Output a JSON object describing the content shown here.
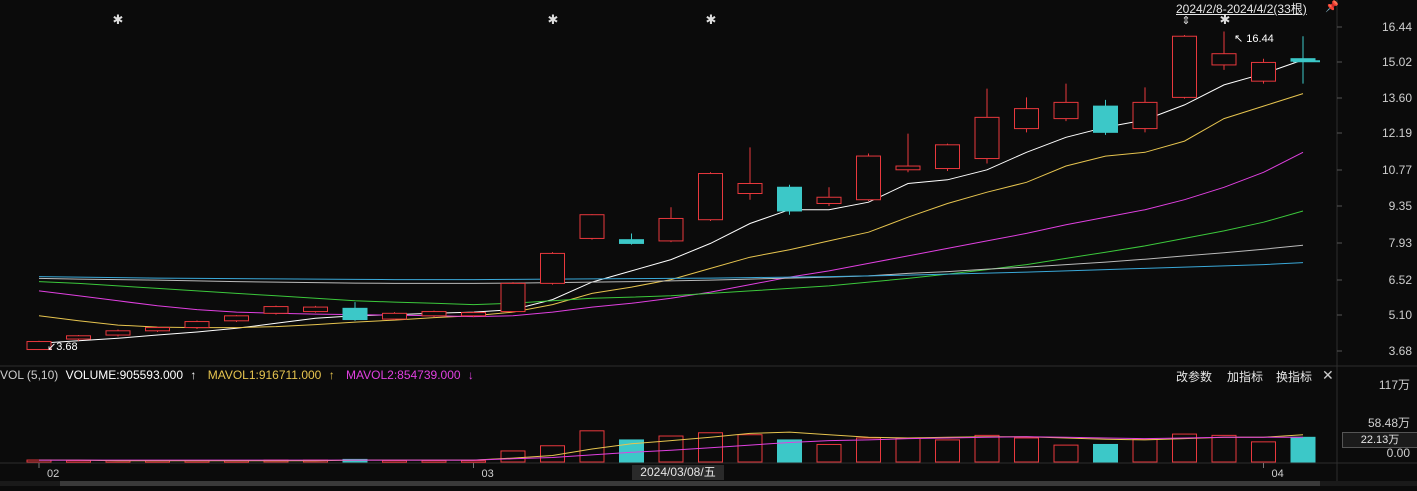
{
  "range_label": "2024/2/8-2024/4/2(33根)",
  "max_marker": "16.44",
  "min_marker": "3.68",
  "price_ticks": [
    "16.44",
    "15.02",
    "13.60",
    "12.19",
    "10.77",
    "9.35",
    "7.93",
    "6.52",
    "5.10",
    "3.68"
  ],
  "volume_ticks": [
    "117万",
    "58.48万",
    "0.00"
  ],
  "current_volume": "22.13万",
  "date_labels": [
    "02",
    "03",
    "04"
  ],
  "crosshair_date": "2024/03/08/五",
  "volume_legend": {
    "name": "VOL (5,10)",
    "volume": "VOLUME:905593.000",
    "volume_arrow": "↑",
    "mavol1": "MAVOL1:916711.000",
    "mavol1_arrow": "↑",
    "mavol2": "MAVOL2:854739.000",
    "mavol2_arrow": "↓"
  },
  "buttons": {
    "params": "改参数",
    "add_indicator": "加指标",
    "switch_indicator": "换指标"
  },
  "colors": {
    "up": "#e8383d",
    "down": "#3cc8c8",
    "ma5": "#ffffff",
    "ma10": "#e6c44f",
    "ma20": "#e040e0",
    "ma30": "#3cc83c",
    "ma60": "#bbbbbb",
    "ma120": "#3aa8d8",
    "mavol1": "#e6c44f",
    "mavol2": "#e040e0",
    "background": "#0b0b0b"
  },
  "chart_data": {
    "type": "candlestick",
    "price_ylim": [
      3.2,
      16.9
    ],
    "volume_ylim": [
      0,
      117
    ],
    "candles": [
      {
        "o": 3.7,
        "c": 4.02,
        "h": 4.05,
        "l": 3.68
      },
      {
        "o": 4.12,
        "c": 4.25,
        "h": 4.28,
        "l": 4.05
      },
      {
        "o": 4.28,
        "c": 4.45,
        "h": 4.5,
        "l": 4.22
      },
      {
        "o": 4.45,
        "c": 4.58,
        "h": 4.62,
        "l": 4.4
      },
      {
        "o": 4.58,
        "c": 4.82,
        "h": 4.86,
        "l": 4.52
      },
      {
        "o": 4.85,
        "c": 5.05,
        "h": 5.08,
        "l": 4.8
      },
      {
        "o": 5.15,
        "c": 5.42,
        "h": 5.46,
        "l": 5.1
      },
      {
        "o": 5.22,
        "c": 5.4,
        "h": 5.45,
        "l": 5.18
      },
      {
        "o": 5.35,
        "c": 4.9,
        "h": 5.6,
        "l": 4.85
      },
      {
        "o": 4.92,
        "c": 5.15,
        "h": 5.2,
        "l": 4.88
      },
      {
        "o": 5.05,
        "c": 5.22,
        "h": 5.26,
        "l": 5.0
      },
      {
        "o": 5.05,
        "c": 5.18,
        "h": 5.22,
        "l": 5.0
      },
      {
        "o": 5.22,
        "c": 6.35,
        "h": 6.4,
        "l": 5.18
      },
      {
        "o": 6.35,
        "c": 7.55,
        "h": 7.6,
        "l": 6.3
      },
      {
        "o": 8.15,
        "c": 9.1,
        "h": 9.12,
        "l": 8.1
      },
      {
        "o": 8.1,
        "c": 7.95,
        "h": 8.35,
        "l": 7.9
      },
      {
        "o": 8.05,
        "c": 8.95,
        "h": 9.4,
        "l": 8.0
      },
      {
        "o": 8.9,
        "c": 10.75,
        "h": 10.8,
        "l": 8.85
      },
      {
        "o": 9.95,
        "c": 10.35,
        "h": 11.8,
        "l": 9.7
      },
      {
        "o": 10.2,
        "c": 9.25,
        "h": 10.3,
        "l": 9.1
      },
      {
        "o": 9.55,
        "c": 9.8,
        "h": 10.2,
        "l": 9.45
      },
      {
        "o": 9.7,
        "c": 11.45,
        "h": 11.55,
        "l": 9.65
      },
      {
        "o": 10.9,
        "c": 11.05,
        "h": 12.35,
        "l": 10.8
      },
      {
        "o": 10.95,
        "c": 11.9,
        "h": 11.95,
        "l": 10.85
      },
      {
        "o": 11.35,
        "c": 13.0,
        "h": 14.15,
        "l": 11.15
      },
      {
        "o": 12.55,
        "c": 13.35,
        "h": 13.8,
        "l": 12.4
      },
      {
        "o": 12.95,
        "c": 13.6,
        "h": 14.35,
        "l": 12.85
      },
      {
        "o": 13.45,
        "c": 12.4,
        "h": 13.7,
        "l": 12.3
      },
      {
        "o": 12.55,
        "c": 13.6,
        "h": 14.2,
        "l": 12.4
      },
      {
        "o": 13.8,
        "c": 16.25,
        "h": 16.3,
        "l": 13.75
      },
      {
        "o": 15.1,
        "c": 15.55,
        "h": 16.44,
        "l": 14.9
      },
      {
        "o": 14.45,
        "c": 15.2,
        "h": 15.35,
        "l": 14.35
      },
      {
        "o": 15.35,
        "c": 15.25,
        "h": 16.25,
        "l": 14.35
      }
    ],
    "volumes": [
      3,
      2,
      2,
      2,
      2,
      2,
      3,
      3,
      4,
      2,
      2,
      2,
      17,
      25,
      48,
      34,
      40,
      45,
      42,
      34,
      27,
      37,
      37,
      34,
      41,
      37,
      26,
      27,
      35,
      43,
      41,
      31,
      38
    ],
    "ma_lines": [
      {
        "name": "MA5",
        "values": [
          3.95,
          4.05,
          4.15,
          4.28,
          4.4,
          4.55,
          4.75,
          4.95,
          5.05,
          5.1,
          5.15,
          5.2,
          5.3,
          5.7,
          6.4,
          6.85,
          7.3,
          7.95,
          8.75,
          9.3,
          9.3,
          9.6,
          10.35,
          10.5,
          10.9,
          11.6,
          12.2,
          12.6,
          12.9,
          13.5,
          14.3,
          14.75,
          15.3
        ]
      },
      {
        "name": "MA10",
        "values": [
          5.05,
          4.85,
          4.68,
          4.6,
          4.58,
          4.58,
          4.62,
          4.7,
          4.8,
          4.88,
          4.98,
          5.05,
          5.2,
          5.5,
          5.95,
          6.2,
          6.5,
          6.95,
          7.4,
          7.7,
          8.05,
          8.4,
          9.0,
          9.55,
          10.0,
          10.4,
          11.05,
          11.45,
          11.6,
          12.05,
          12.95,
          13.45,
          13.95
        ]
      },
      {
        "name": "MA20",
        "values": [
          6.05,
          5.85,
          5.65,
          5.45,
          5.3,
          5.2,
          5.15,
          5.12,
          5.1,
          5.08,
          5.05,
          5.02,
          5.05,
          5.2,
          5.4,
          5.55,
          5.75,
          6.0,
          6.3,
          6.6,
          6.85,
          7.15,
          7.45,
          7.75,
          8.05,
          8.35,
          8.7,
          9.0,
          9.3,
          9.7,
          10.2,
          10.8,
          11.6
        ]
      },
      {
        "name": "MA30",
        "values": [
          6.42,
          6.35,
          6.25,
          6.15,
          6.05,
          5.95,
          5.85,
          5.75,
          5.65,
          5.6,
          5.55,
          5.5,
          5.55,
          5.65,
          5.75,
          5.8,
          5.85,
          5.95,
          6.05,
          6.15,
          6.25,
          6.4,
          6.55,
          6.72,
          6.9,
          7.1,
          7.35,
          7.6,
          7.85,
          8.15,
          8.45,
          8.8,
          9.25
        ]
      },
      {
        "name": "MA60",
        "values": [
          6.55,
          6.52,
          6.5,
          6.48,
          6.45,
          6.42,
          6.4,
          6.38,
          6.36,
          6.35,
          6.35,
          6.35,
          6.36,
          6.38,
          6.4,
          6.42,
          6.45,
          6.48,
          6.52,
          6.56,
          6.6,
          6.65,
          6.75,
          6.82,
          6.92,
          7.0,
          7.1,
          7.2,
          7.32,
          7.45,
          7.58,
          7.72,
          7.88
        ]
      },
      {
        "name": "MA120",
        "values": [
          6.62,
          6.6,
          6.58,
          6.56,
          6.55,
          6.54,
          6.53,
          6.52,
          6.51,
          6.5,
          6.5,
          6.5,
          6.51,
          6.52,
          6.53,
          6.54,
          6.55,
          6.56,
          6.58,
          6.6,
          6.62,
          6.65,
          6.68,
          6.72,
          6.76,
          6.8,
          6.85,
          6.9,
          6.95,
          7.0,
          7.05,
          7.1,
          7.18
        ]
      }
    ],
    "mavol_lines": [
      {
        "name": "MAVOL1",
        "values": [
          3,
          3,
          2,
          2,
          2,
          2,
          2,
          2,
          3,
          3,
          3,
          3,
          6,
          10,
          20,
          28,
          33,
          38,
          44,
          46,
          42,
          38,
          37,
          38,
          39,
          39,
          37,
          35,
          34,
          36,
          38,
          38,
          42
        ]
      },
      {
        "name": "MAVOL2",
        "values": [
          3,
          3,
          3,
          3,
          3,
          3,
          3,
          3,
          3,
          3,
          3,
          3,
          5,
          7,
          11,
          15,
          18,
          22,
          26,
          30,
          33,
          34,
          36,
          37,
          38,
          39,
          38,
          37,
          36,
          37,
          38,
          38,
          38
        ]
      }
    ],
    "date_ticks": [
      {
        "label": "02",
        "index": 0
      },
      {
        "label": "03",
        "index": 11
      },
      {
        "label": "04",
        "index": 31
      }
    ]
  }
}
